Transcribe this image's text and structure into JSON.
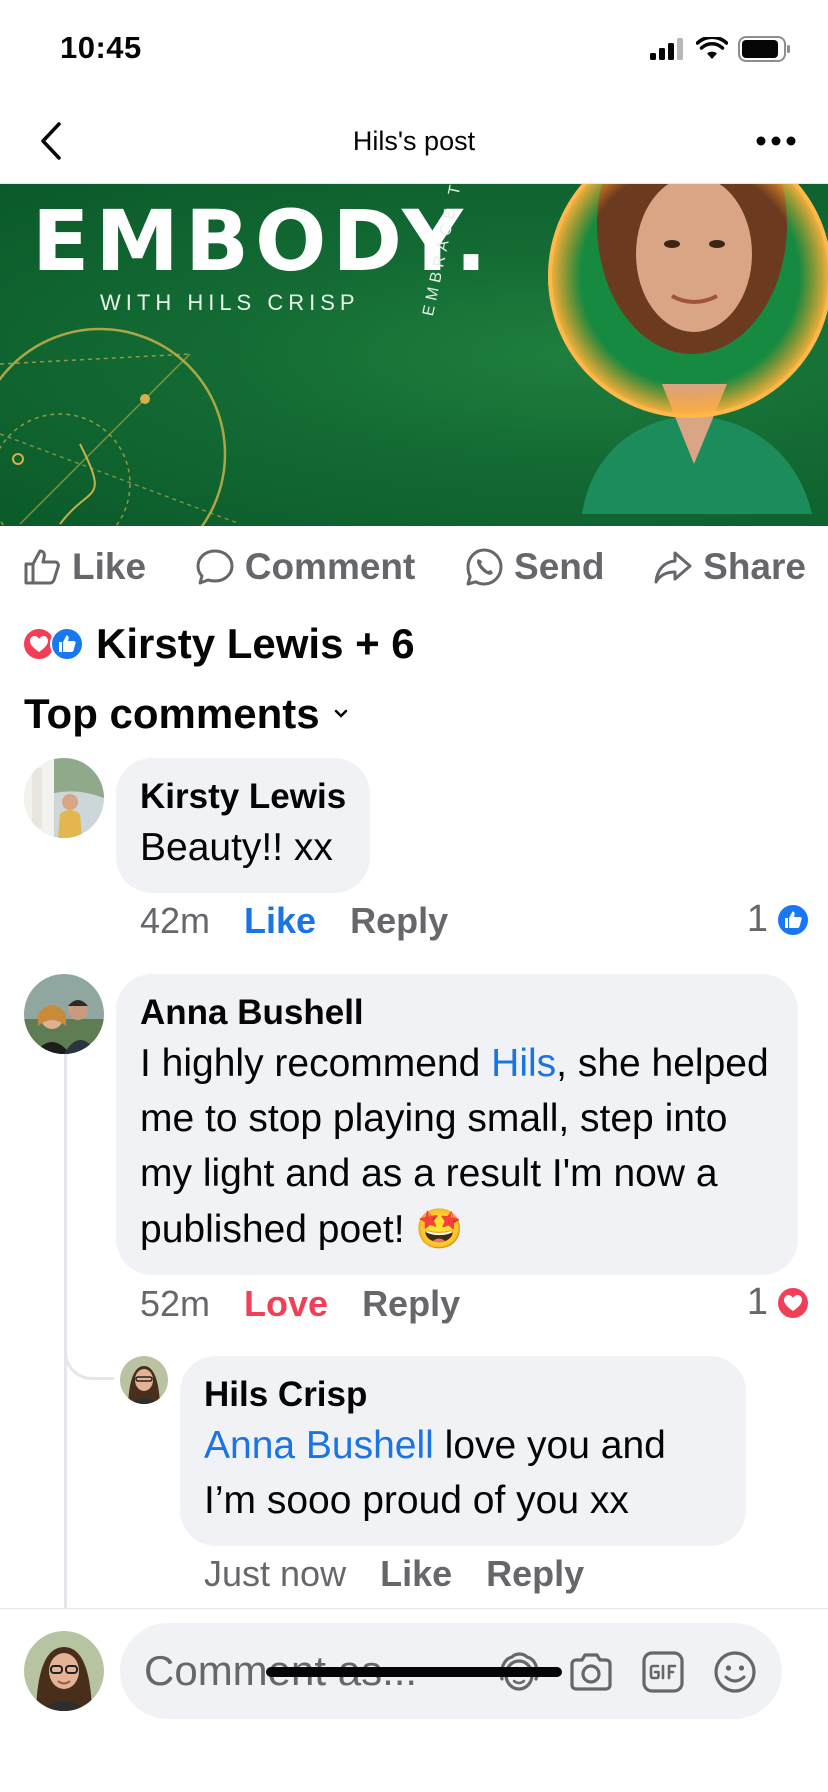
{
  "status_bar": {
    "time": "10:45"
  },
  "header": {
    "title": "Hils's post"
  },
  "banner": {
    "logo": "EMBODY.",
    "subtitle": "WITH HILS CRISP",
    "tagline": "EMBRACE THE",
    "accent_color": "#136b33"
  },
  "actions": [
    {
      "label": "Like",
      "icon": "thumbs-up-icon"
    },
    {
      "label": "Comment",
      "icon": "comment-icon"
    },
    {
      "label": "Send",
      "icon": "whatsapp-icon"
    },
    {
      "label": "Share",
      "icon": "share-icon"
    }
  ],
  "reactions_summary": {
    "text": "Kirsty Lewis + 6",
    "icons": [
      "love-icon",
      "like-icon"
    ]
  },
  "sort": {
    "label": "Top comments"
  },
  "comments": [
    {
      "author": "Kirsty Lewis",
      "text": "Beauty!! xx",
      "time": "42m",
      "reaction_label": "Like",
      "reaction_color": "#1b74e4",
      "reply_label": "Reply",
      "reaction_count": "1",
      "reaction_icon": "like-icon"
    },
    {
      "author": "Anna Bushell",
      "text_before": "I highly recommend ",
      "mention": "Hils",
      "text_after": ", she helped me to stop playing small, step into my light and as a result I'm now a published poet! 🤩",
      "time": "52m",
      "reaction_label": "Love",
      "reaction_color": "#f33e58",
      "reply_label": "Reply",
      "reaction_count": "1",
      "reaction_icon": "love-icon"
    }
  ],
  "reply": {
    "author": "Hils Crisp",
    "mention": "Anna Bushell",
    "text_after": " love you and I’m sooo proud of you xx",
    "time": "Just now",
    "like_label": "Like",
    "reply_label": "Reply"
  },
  "composer": {
    "placeholder": "Comment as...",
    "icons": [
      "avatar-sticker-icon",
      "camera-icon",
      "gif-icon",
      "emoji-icon"
    ]
  },
  "colors": {
    "link": "#1b74e4",
    "love": "#f33e58",
    "muted": "#65676b",
    "bubble": "#f0f2f5"
  }
}
